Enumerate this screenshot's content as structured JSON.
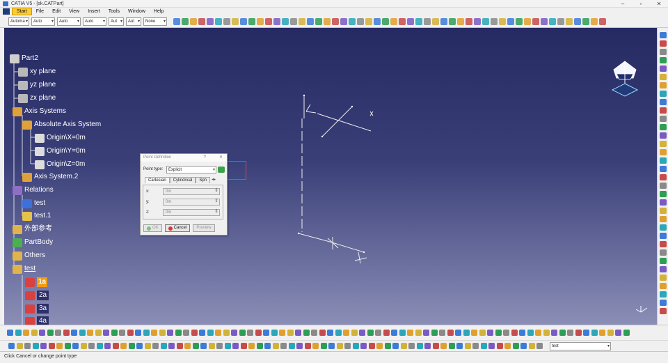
{
  "window": {
    "title": "CATIA V5 - [sk.CATPart]"
  },
  "menu": [
    "Start",
    "File",
    "Edit",
    "View",
    "Insert",
    "Tools",
    "Window",
    "Help"
  ],
  "toolbar_combos": [
    "Automa",
    "Auto",
    "Auto",
    "Auto",
    "Aut",
    "Aut",
    "None"
  ],
  "tree": {
    "root": "Part2",
    "items": [
      {
        "label": "xy plane",
        "icon": "plane-icon"
      },
      {
        "label": "yz plane",
        "icon": "plane-icon"
      },
      {
        "label": "zx plane",
        "icon": "plane-icon"
      },
      {
        "label": "Axis Systems",
        "icon": "axis-system-icon"
      },
      {
        "label": "Absolute Axis System",
        "icon": "axis-system-icon"
      },
      {
        "label": "Origin\\X=0m",
        "icon": "parameter-icon"
      },
      {
        "label": "Origin\\Y=0m",
        "icon": "parameter-icon"
      },
      {
        "label": "Origin\\Z=0m",
        "icon": "parameter-icon"
      },
      {
        "label": "Axis System.2",
        "icon": "axis-system-icon"
      },
      {
        "label": "Relations",
        "icon": "relations-icon"
      },
      {
        "label": "test",
        "icon": "table-icon"
      },
      {
        "label": "test.1",
        "icon": "rule-icon"
      },
      {
        "label": "外部参考",
        "icon": "geometrical-set-icon"
      },
      {
        "label": "PartBody",
        "icon": "body-icon"
      },
      {
        "label": "Others",
        "icon": "geometrical-set-icon"
      },
      {
        "label": "test",
        "icon": "geometrical-set-icon"
      },
      {
        "label": "1a",
        "icon": "point-icon"
      },
      {
        "label": "2a",
        "icon": "point-icon"
      },
      {
        "label": "3a",
        "icon": "point-icon"
      },
      {
        "label": "4a",
        "icon": "point-icon"
      }
    ]
  },
  "dialog": {
    "title": "Point Definition",
    "help": "?",
    "close": "✕",
    "point_type_label": "Point type:",
    "point_type_value": "Explicit",
    "tabs": [
      "Cartesian",
      "Cylindrical",
      "Sph"
    ],
    "tab_arrows": "◂▸",
    "fields": [
      {
        "label": "x:",
        "value": "0m"
      },
      {
        "label": "y:",
        "value": "0m"
      },
      {
        "label": "z:",
        "value": "0m"
      }
    ],
    "ok": "OK",
    "cancel": "Cancel",
    "preview": "Preview"
  },
  "bottom_combo": "test",
  "status": "Click Cancel or change point type",
  "colors": {
    "viewport_top": "#262a63",
    "viewport_bottom": "#8b8fb6",
    "highlight": "#f39c12",
    "selection_box": "#e0404f"
  }
}
